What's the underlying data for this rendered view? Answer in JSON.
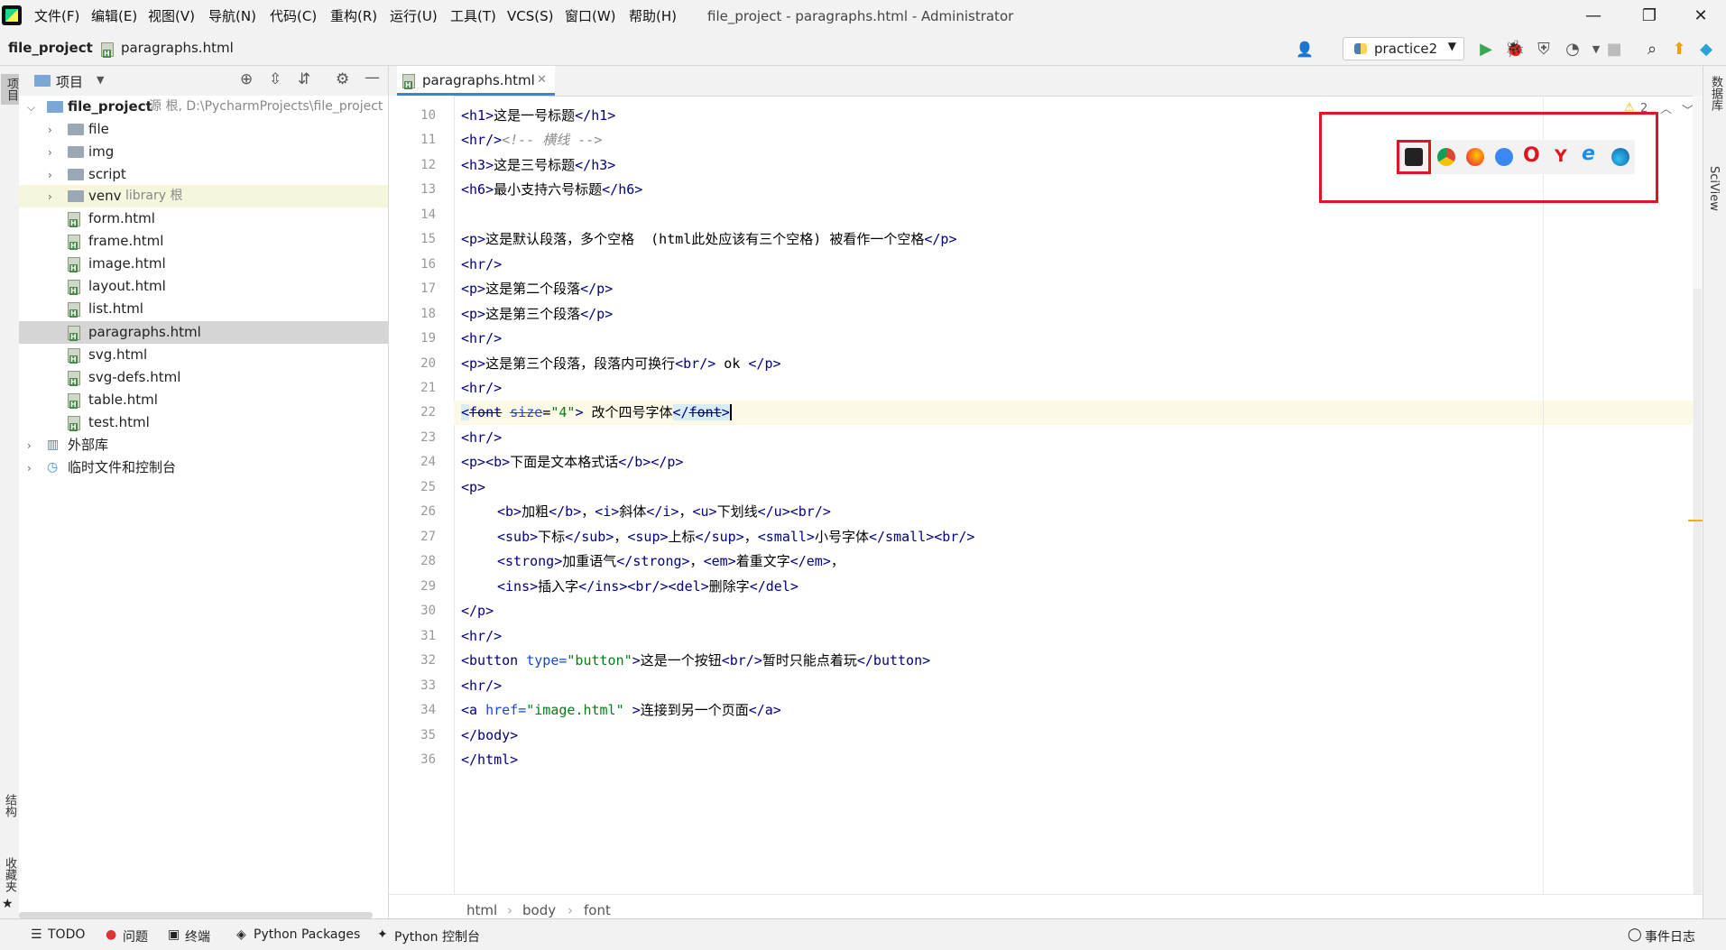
{
  "window": {
    "menu": [
      "文件(F)",
      "编辑(E)",
      "视图(V)",
      "导航(N)",
      "代码(C)",
      "重构(R)",
      "运行(U)",
      "工具(T)",
      "VCS(S)",
      "窗口(W)",
      "帮助(H)"
    ],
    "title": "file_project - paragraphs.html - Administrator",
    "minimize": "—",
    "restore": "❐",
    "close": "✕"
  },
  "navbar": {
    "project": "file_project",
    "file": "paragraphs.html",
    "run_config": "practice2"
  },
  "left_strip": {
    "top": "项目",
    "bottom1": "结构",
    "bottom2": "收藏夹"
  },
  "project_panel": {
    "title": "项目",
    "root": {
      "name": "file_project",
      "hint": "源 根, D:\\PycharmProjects\\file_project"
    },
    "folders": [
      "file",
      "img",
      "script"
    ],
    "venv": {
      "name": "venv",
      "hint": "library 根"
    },
    "files": [
      "form.html",
      "frame.html",
      "image.html",
      "layout.html",
      "list.html",
      "paragraphs.html",
      "svg.html",
      "svg-defs.html",
      "table.html",
      "test.html"
    ],
    "external": "外部库",
    "scratch": "临时文件和控制台"
  },
  "editor": {
    "tab": "paragraphs.html",
    "inspection_count": "2",
    "line_numbers": [
      "10",
      "11",
      "12",
      "13",
      "14",
      "15",
      "16",
      "17",
      "18",
      "19",
      "20",
      "21",
      "22",
      "23",
      "24",
      "25",
      "26",
      "27",
      "28",
      "29",
      "30",
      "31",
      "32",
      "33",
      "34",
      "35",
      "36"
    ],
    "breadcrumb": [
      "html",
      "body",
      "font"
    ]
  },
  "code": {
    "l10": [
      "<h1>",
      "这是一号标题",
      "</h1>"
    ],
    "l11": [
      "<hr/>",
      "<!-- 横线 -->"
    ],
    "l12": [
      "<h3>",
      "这是三号标题",
      "</h3>"
    ],
    "l13": [
      "<h6>",
      "最小支持六号标题",
      "</h6>"
    ],
    "l15": [
      "<p>",
      "这是默认段落，多个空格  (html此处应该有三个空格) 被看作一个空格",
      "</p>"
    ],
    "l16": "<hr/>",
    "l17": [
      "<p>",
      "这是第二个段落",
      "</p>"
    ],
    "l18": [
      "<p>",
      "这是第三个段落",
      "</p>"
    ],
    "l19": "<hr/>",
    "l20": [
      "<p>",
      "这是第三个段落，段落内可换行",
      "<br/>",
      " ok ",
      "</p>"
    ],
    "l21": "<hr/>",
    "l22": [
      "<",
      "font",
      " ",
      "size",
      "=",
      "\"4\"",
      ">",
      " 改个四号字体",
      "</",
      "font",
      ">"
    ],
    "l23": "<hr/>",
    "l24": [
      "<p>",
      "<b>",
      "下面是文本格式话",
      "</b>",
      "</p>"
    ],
    "l25": "<p>",
    "l26": [
      "<b>",
      "加粗",
      "</b>",
      "，",
      "<i>",
      "斜体",
      "</i>",
      "，",
      "<u>",
      "下划线",
      "</u>",
      "<br/>"
    ],
    "l27": [
      "<sub>",
      "下标",
      "</sub>",
      "，",
      "<sup>",
      "上标",
      "</sup>",
      "，",
      "<small>",
      "小号字体",
      "</small>",
      "<br/>"
    ],
    "l28": [
      "<strong>",
      "加重语气",
      "</strong>",
      "，",
      "<em>",
      "着重文字",
      "</em>",
      "，"
    ],
    "l29": [
      "<ins>",
      "插入字",
      "</ins>",
      "<br/>",
      "<del>",
      "删除字",
      "</del>"
    ],
    "l30": "</p>",
    "l31": "<hr/>",
    "l32": [
      "<button",
      " type=",
      "\"button\"",
      ">",
      "这是一个按钮",
      "<br/>",
      "暂时只能点着玩",
      "</button>"
    ],
    "l33": "<hr/>",
    "l34": [
      "<a",
      " href=",
      "\"image.html\"",
      " >",
      "连接到另一个页面",
      "</a>"
    ],
    "l35": "</body>",
    "l36": "</html>"
  },
  "right_strip": {
    "db": "数据库",
    "sciview": "SciView"
  },
  "statusbar": {
    "todo": "TODO",
    "problems": "问题",
    "terminal": "终端",
    "packages": "Python Packages",
    "console": "Python 控制台",
    "eventlog": "事件日志"
  },
  "colors": {
    "accent": "#4083c9",
    "highlight_box": "#e0161e",
    "selection": "#d5d5d5"
  }
}
